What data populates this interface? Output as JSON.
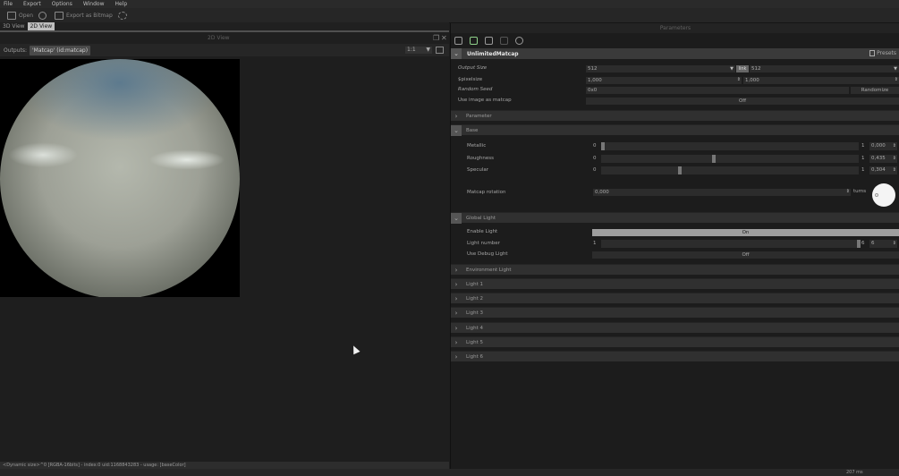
{
  "menu": [
    "File",
    "Export",
    "Options",
    "Window",
    "Help"
  ],
  "toolbar": {
    "open": "Open",
    "export": "Export as Bitmap"
  },
  "tabs": [
    "3D View",
    "2D View"
  ],
  "view": {
    "title": "2D View",
    "outputs_label": "Outputs:",
    "output_selected": "'Matcap' (id:matcap)",
    "zoom": "1:1"
  },
  "statusbar": "<Dynamic size>^0 [RGBA-16bits] - index:0 uid:1168843283 - usage: [baseColor]",
  "bottom_time": "207 ms",
  "panel": {
    "title": "Parameters",
    "node_name": "UnlimitedMatcap",
    "presets": "Presets",
    "output_size_label": "Output Size",
    "output_size_w": "512",
    "output_size_h": "512",
    "link_label": "link",
    "pixelsize_label": "$pixelsize",
    "pixelsize_x": "1,000",
    "pixelsize_y": "1,000",
    "random_seed_label": "Random Seed",
    "random_seed_value": "0x0",
    "randomize": "Randomize",
    "use_image_label": "Use image as matcap",
    "use_image_value": "Off",
    "sections": {
      "parameter": "Parameter",
      "base": "Base",
      "global_light": "Global Light",
      "environment_light": "Environment Light",
      "light1": "Light 1",
      "light2": "Light 2",
      "light3": "Light 3",
      "light4": "Light 4",
      "light5": "Light 5",
      "light6": "Light 6"
    },
    "base": {
      "metallic_label": "Metallic",
      "metallic_min": "0",
      "metallic_max": "1",
      "metallic_value": "0,000",
      "metallic_fraction": 0.0,
      "roughness_label": "Roughness",
      "roughness_min": "0",
      "roughness_max": "1",
      "roughness_value": "0,435",
      "roughness_fraction": 0.435,
      "specular_label": "Specular",
      "specular_min": "0",
      "specular_max": "1",
      "specular_value": "0,304",
      "specular_fraction": 0.304,
      "rotation_label": "Matcap rotation",
      "rotation_value": "0,000",
      "rotation_unit": "turns"
    },
    "global_light": {
      "enable_label": "Enable Light",
      "enable_value": "On",
      "number_label": "Light number",
      "number_min": "1",
      "number_max": "6",
      "number_value": "6",
      "number_fraction": 1.0,
      "debug_label": "Use Debug Light",
      "debug_value": "Off"
    }
  }
}
